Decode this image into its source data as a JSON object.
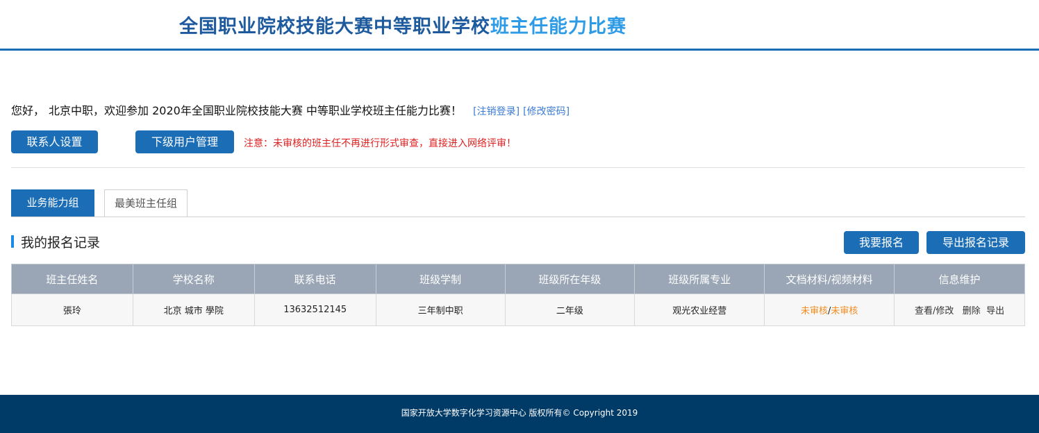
{
  "header": {
    "title_main": "全国职业院校技能大赛中等职业学校",
    "title_highlight": "班主任能力比赛"
  },
  "greeting": {
    "hello": "您好，",
    "user": "北京中职",
    "welcome": "，欢迎参加 2020年全国职业院校技能大赛 中等职业学校班主任能力比赛！",
    "logout": "[注销登录]",
    "change_password": "[修改密码]"
  },
  "actions": {
    "contact_settings": "联系人设置",
    "sub_users": "下级用户管理",
    "notice": "注意：未审核的班主任不再进行形式审查，直接进入网络评审！"
  },
  "tabs": [
    {
      "label": "业务能力组",
      "active": true
    },
    {
      "label": "最美班主任组",
      "active": false
    }
  ],
  "section": {
    "title": "我的报名记录",
    "register_button": "我要报名",
    "export_button": "导出报名记录"
  },
  "table": {
    "headers": [
      "班主任姓名",
      "学校名称",
      "联系电话",
      "班级学制",
      "班级所在年级",
      "班级所属专业",
      "文档材料/视频材料",
      "信息维护"
    ],
    "rows": [
      {
        "name": "張玲",
        "school": "北京 城市 學院",
        "phone": "13632512145",
        "system": "三年制中职",
        "grade": "二年级",
        "major": "观光农业经营",
        "doc_status": "未审核",
        "separator": "/",
        "video_status": "未审核",
        "view_edit": "查看/修改",
        "delete": "删除",
        "export": "导出"
      }
    ]
  },
  "footer": {
    "text": "国家开放大学数字化学习资源中心 版权所有© Copyright 2019"
  },
  "colors": {
    "primary": "#1b6db5",
    "title_dark": "#1e5a9e",
    "title_light": "#2e9be6",
    "notice_red": "#e02020",
    "status_orange": "#f08c1c",
    "table_header": "#9aa6b6",
    "footer_bg": "#003a66"
  }
}
